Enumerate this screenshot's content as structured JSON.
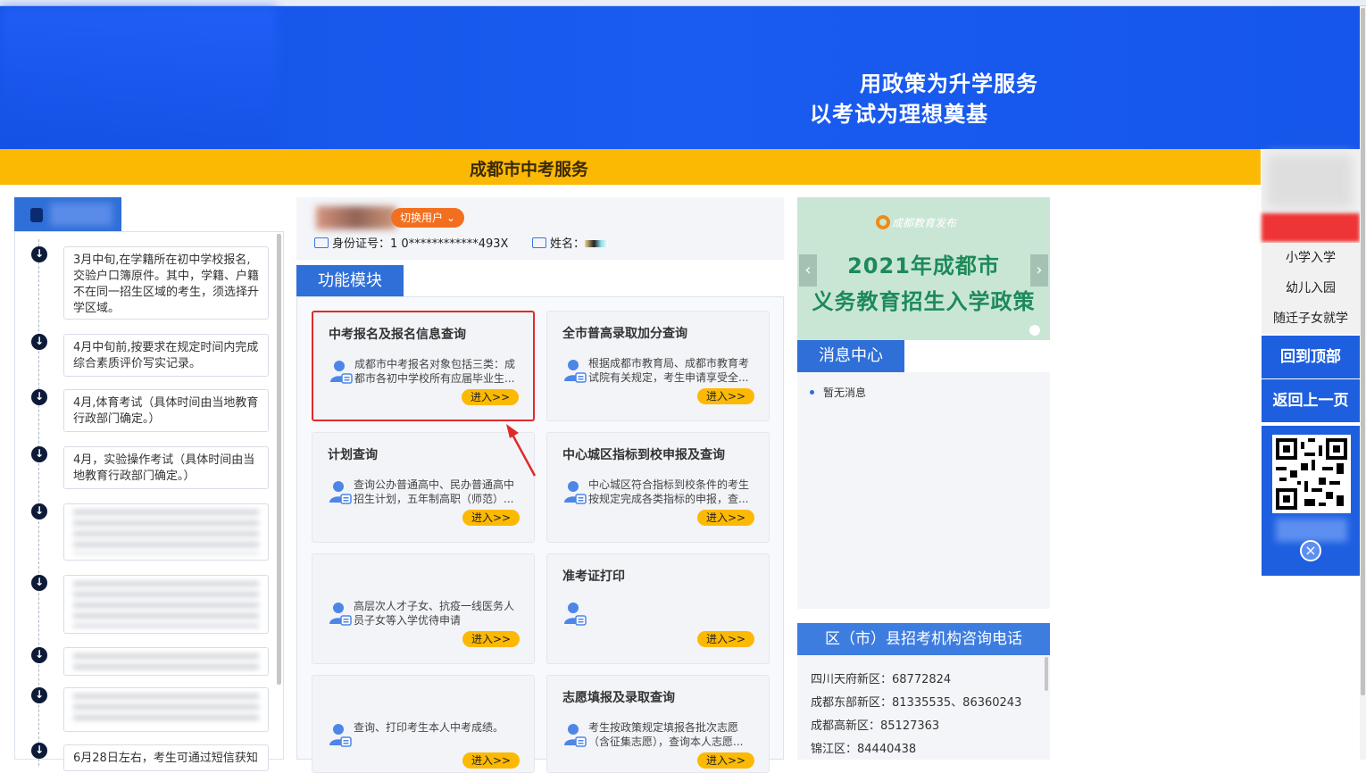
{
  "banner": {
    "slogan_line1": "用政策为升学服务",
    "slogan_line2": "以考试为理想奠基"
  },
  "header": {
    "title": "成都市中考服务"
  },
  "timeline": {
    "items": [
      {
        "text": "3月中旬,在学籍所在初中学校报名,交验户口簿原件。其中，学籍、户籍不在同一招生区域的考生，须选择升学区域。",
        "blurred": false
      },
      {
        "text": "4月中旬前,按要求在规定时间内完成综合素质评价写实记录。",
        "blurred": false
      },
      {
        "text": "4月,体育考试（具体时间由当地教育行政部门确定。）",
        "blurred": false
      },
      {
        "text": "4月，实验操作考试（具体时间由当地教育行政部门确定。）",
        "blurred": false
      },
      {
        "text": "",
        "blurred": true
      },
      {
        "text": "",
        "blurred": true
      },
      {
        "text": "",
        "blurred": true
      },
      {
        "text": "",
        "blurred": true
      },
      {
        "text": "6月28日左右，考生可通过短信获知",
        "blurred": false
      }
    ]
  },
  "user": {
    "switch_label": "切换用户 ⌄",
    "id_label": "身份证号：",
    "id_value": "1 0************493X",
    "name_label": "姓名："
  },
  "functions": {
    "tab_label": "功能模块",
    "enter_label": "进入>>",
    "cards": [
      {
        "title": "中考报名及报名信息查询",
        "desc": "成都市中考报名对象包括三类：成都市各初中学校所有应届毕业生..."
      },
      {
        "title": "全市普高录取加分查询",
        "desc": "根据成都市教育局、成都市教育考试院有关规定，考生申请享受全..."
      },
      {
        "title": "计划查询",
        "desc": "查询公办普通高中、民办普通高中招生计划，五年制高职（师范）..."
      },
      {
        "title": "中心城区指标到校申报及查询",
        "desc": "中心城区符合指标到校条件的考生按规定完成各类指标的申报，查..."
      },
      {
        "title": "",
        "desc": "高层次人才子女、抗疫一线医务人员子女等入学优待申请"
      },
      {
        "title": "准考证打印",
        "desc": ""
      },
      {
        "title": "",
        "desc": "查询、打印考生本人中考成绩。"
      },
      {
        "title": "志愿填报及录取查询",
        "desc": "考生按政策规定填报各批次志愿（含征集志愿），查询本人志愿..."
      }
    ]
  },
  "carousel": {
    "logo_text": "成都教育发布",
    "line1": "2021年成都市",
    "line2": "义务教育招生入学政策",
    "prev": "‹",
    "next": "›"
  },
  "messages": {
    "tab_label": "消息中心",
    "items": [
      "暂无消息"
    ]
  },
  "phones": {
    "title": "区（市）县招考机构咨询电话",
    "rows": [
      "四川天府新区：68772824",
      "成都东部新区：81335535、86360243",
      "成都高新区：85127363",
      "锦江区：84440438"
    ]
  },
  "float_menu": {
    "links": [
      "小学入学",
      "幼儿入园",
      "随迁子女就学"
    ],
    "back_top": "回到顶部",
    "back_prev": "返回上一页",
    "close": "×"
  }
}
